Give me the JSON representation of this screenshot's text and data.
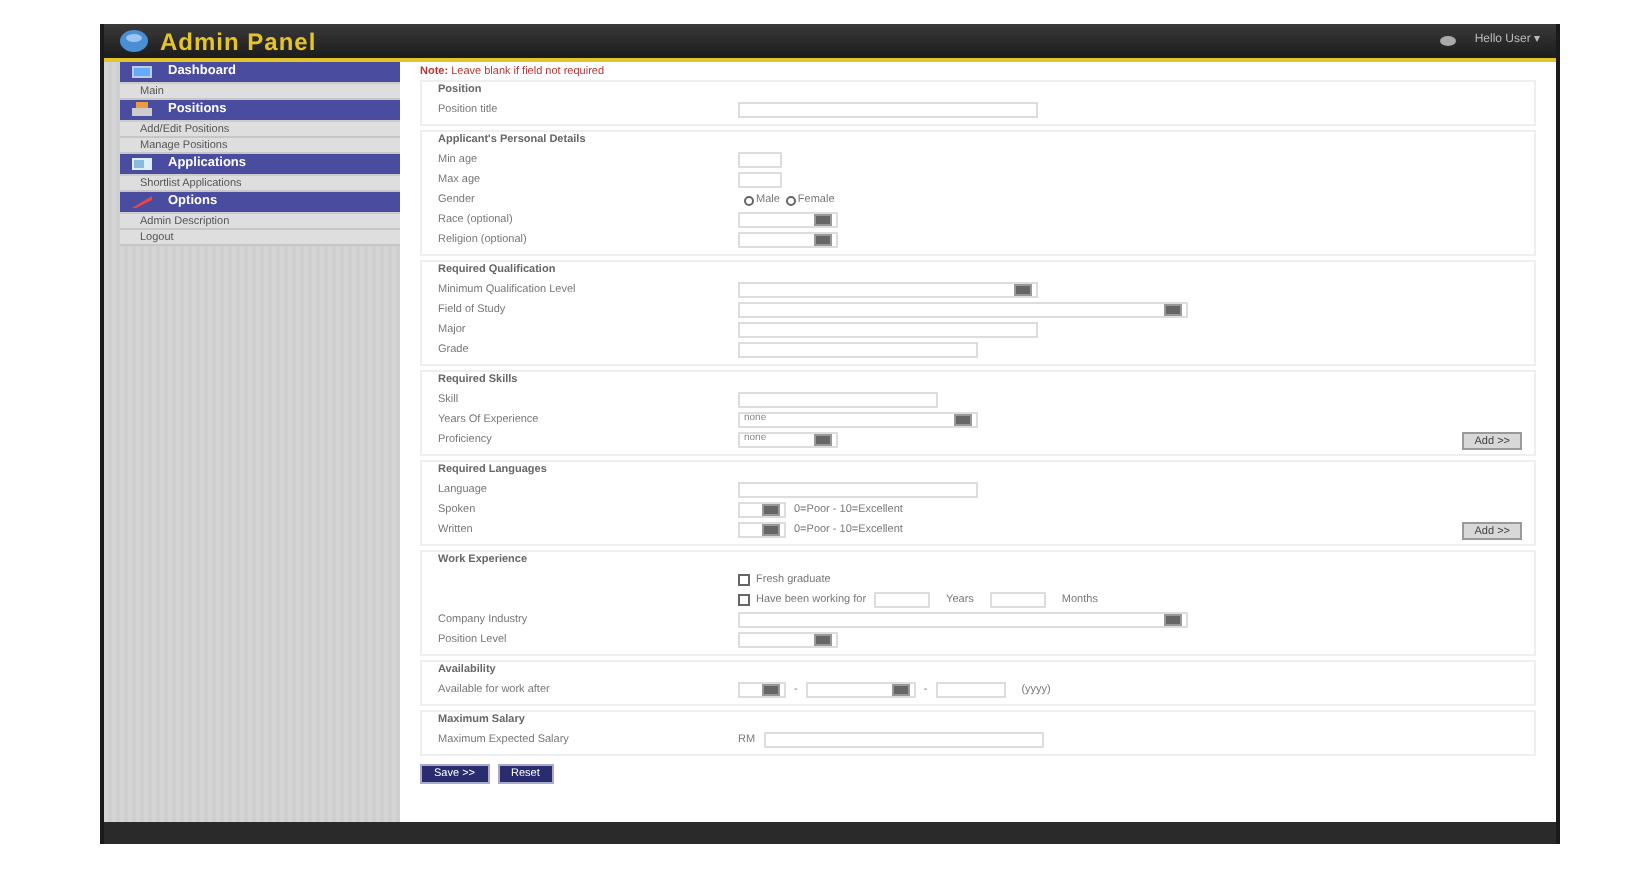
{
  "header": {
    "title": "Admin Panel",
    "user_menu": "Hello User ▾"
  },
  "sidebar": [
    {
      "title": "Dashboard",
      "items": [
        {
          "label": "Main"
        }
      ]
    },
    {
      "title": "Positions",
      "items": [
        {
          "label": "Add/Edit Positions"
        },
        {
          "label": "Manage Positions"
        }
      ]
    },
    {
      "title": "Applications",
      "items": [
        {
          "label": "Shortlist Applications"
        }
      ]
    },
    {
      "title": "Options",
      "items": [
        {
          "label": "Admin Description"
        },
        {
          "label": "Logout"
        }
      ]
    }
  ],
  "note": "**Note:** Leave blank if field not required",
  "sections": [
    {
      "title": "Position",
      "fields": [
        {
          "kind": "text",
          "label": "Position title"
        }
      ]
    },
    {
      "title": "Applicant's Personal Details",
      "fields": [
        {
          "kind": "text",
          "label": "Min age"
        },
        {
          "kind": "text",
          "label": "Max age"
        },
        {
          "kind": "radio",
          "label": "Gender",
          "options": [
            {
              "label": "Male",
              "selected": false
            },
            {
              "label": "Female",
              "selected": false
            }
          ]
        },
        {
          "kind": "select",
          "label": "Race (optional)"
        },
        {
          "kind": "select",
          "label": "Religion (optional)"
        }
      ]
    },
    {
      "title": "Required Qualification",
      "fields": [
        {
          "kind": "select",
          "label": "Minimum Qualification Level"
        },
        {
          "kind": "select",
          "label": "Field of Study"
        },
        {
          "kind": "text",
          "label": "Major"
        },
        {
          "kind": "text",
          "label": "Grade"
        }
      ]
    },
    {
      "title": "Required Skills",
      "fields": [
        {
          "kind": "text",
          "label": "Skill"
        },
        {
          "kind": "select",
          "label": "Years Of Experience",
          "value": "none"
        },
        {
          "kind": "select",
          "label": "Proficiency",
          "value": "none",
          "button": "Add >>"
        }
      ]
    },
    {
      "title": "Required Languages",
      "fields": [
        {
          "kind": "text",
          "label": "Language"
        },
        {
          "kind": "rating",
          "label": "Spoken",
          "hint": "0=Poor - 10=Excellent"
        },
        {
          "kind": "rating",
          "label": "Written",
          "hint": "0=Poor - 10=Excellent",
          "button": "Add >>"
        }
      ]
    },
    {
      "title": "Work Experience",
      "fields": [
        {
          "kind": "checkbox",
          "text": "Fresh graduate",
          "checked": false
        },
        {
          "kind": "duration",
          "text": "Have been working for",
          "checked": false,
          "units": [
            "Years",
            "Months"
          ]
        },
        {
          "kind": "select",
          "label": "Company Industry"
        },
        {
          "kind": "select",
          "label": "Position Level"
        }
      ]
    },
    {
      "title": "Availability",
      "fields": [
        {
          "kind": "date",
          "label": "Available for work after",
          "separators": [
            "-",
            "-"
          ],
          "suffix": "(yyyy)"
        }
      ]
    },
    {
      "title": "Maximum Salary",
      "fields": [
        {
          "kind": "money",
          "label": "Maximum Expected Salary",
          "prefix": "RM"
        }
      ]
    }
  ],
  "buttons": [
    "Save >>",
    "Reset"
  ]
}
